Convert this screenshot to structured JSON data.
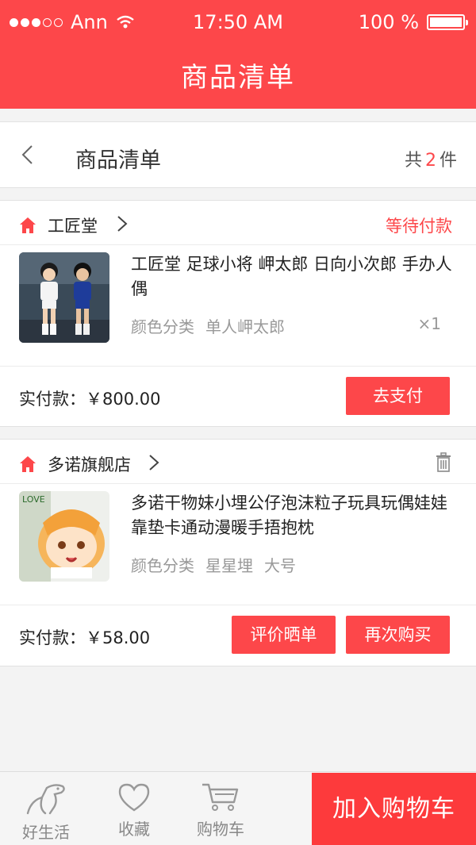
{
  "status_bar": {
    "carrier": "Ann",
    "time": "17:50 AM",
    "battery": "100 %"
  },
  "nav": {
    "title": "商品清单"
  },
  "subbar": {
    "title": "商品清单",
    "count_prefix": "共",
    "count": "2",
    "count_suffix": "件"
  },
  "orders": [
    {
      "shop": "工匠堂",
      "status": "等待付款",
      "product_title": "工匠堂 足球小将 岬太郎 日向小次郎 手办人偶",
      "spec_label": "颜色分类",
      "spec_values": [
        "单人岬太郎"
      ],
      "quantity": "×1",
      "pay_label": "实付款：",
      "pay_amount": "￥800.00",
      "buttons": [
        "去支付"
      ]
    },
    {
      "shop": "多诺旗舰店",
      "product_title": "多诺干物妹小埋公仔泡沫粒子玩具玩偶娃娃靠垫卡通动漫暖手捂抱枕",
      "thumb_text": "LOVE",
      "spec_label": "颜色分类",
      "spec_values": [
        "星星埋",
        "大号"
      ],
      "pay_label": "实付款：",
      "pay_amount": "￥58.00",
      "buttons": [
        "评价晒单",
        "再次购买"
      ]
    }
  ],
  "tabbar": {
    "tabs": [
      {
        "label": "好生活",
        "icon": "dinosaur-icon"
      },
      {
        "label": "收藏",
        "icon": "heart-icon"
      },
      {
        "label": "购物车",
        "icon": "cart-icon"
      }
    ],
    "cta": "加入购物车"
  },
  "colors": {
    "accent": "#fd474a",
    "cta": "#fd3a3c"
  }
}
